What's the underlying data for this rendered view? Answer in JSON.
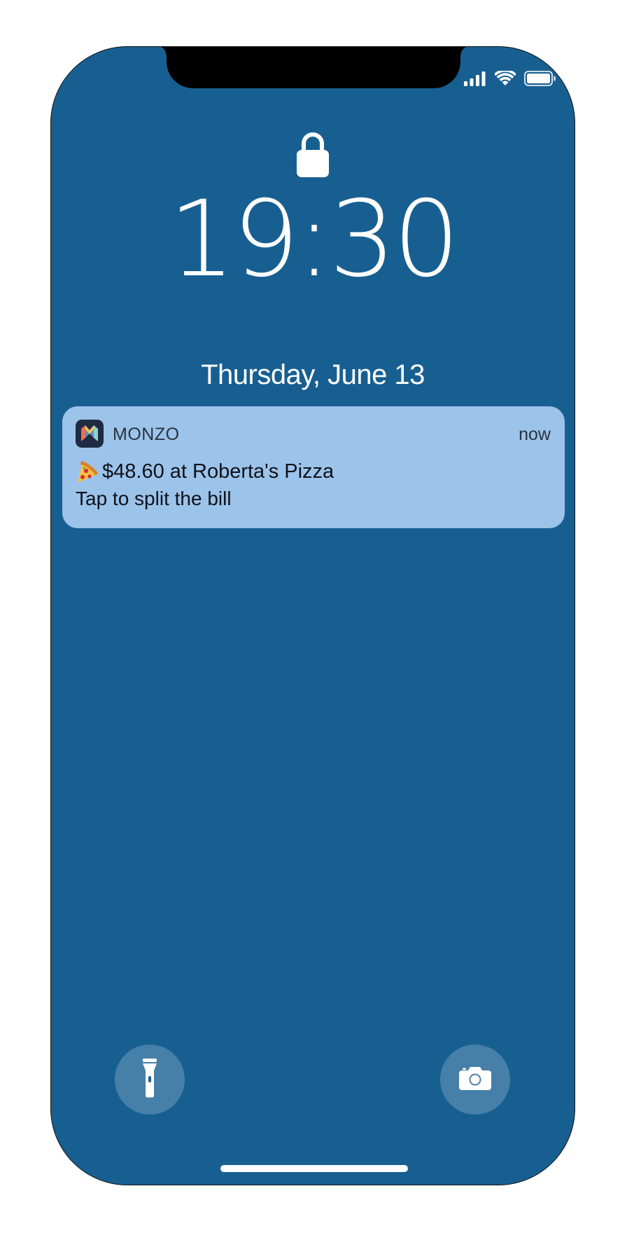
{
  "status_bar": {
    "signal_icon": "cellular-signal-icon",
    "wifi_icon": "wifi-icon",
    "battery_icon": "battery-icon"
  },
  "lock_screen": {
    "lock_icon": "lock-icon",
    "time": "19:30",
    "date": "Thursday, June 13",
    "background_color": "#185f91"
  },
  "notification": {
    "app_name": "MONZO",
    "time": "now",
    "emoji": "🍕",
    "title": "$48.60 at Roberta's Pizza",
    "body": "Tap to split the bill",
    "background_color": "#9cc3ea"
  },
  "quick_actions": {
    "flashlight_icon": "flashlight-icon",
    "camera_icon": "camera-icon"
  }
}
